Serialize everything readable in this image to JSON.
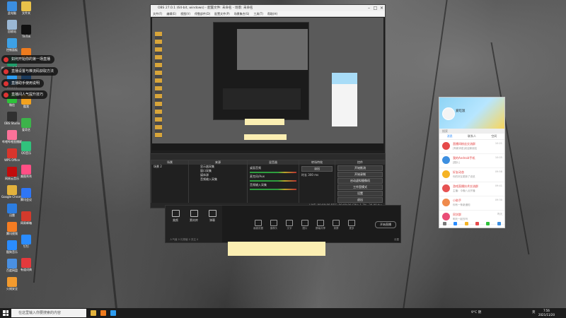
{
  "desktop": {
    "icons_left": [
      {
        "label": "此电脑",
        "color": "#3b8ee0"
      },
      {
        "label": "回收站",
        "color": "#9bb8d4"
      },
      {
        "label": "控制面板",
        "color": "#3da1e6"
      },
      {
        "label": "Microsoft Edge",
        "color": "#1f9d6b"
      },
      {
        "label": "腾讯QQ",
        "color": "#2d9cf0"
      },
      {
        "label": "微信",
        "color": "#2ec23a"
      },
      {
        "label": "OBS Studio",
        "color": "#303030"
      },
      {
        "label": "哔哩哔哩直播姬",
        "color": "#fb7299"
      },
      {
        "label": "WPS Office",
        "color": "#d9352c"
      },
      {
        "label": "网易云音乐",
        "color": "#c20c0c"
      },
      {
        "label": "Google Chrome",
        "color": "#e3b23c"
      },
      {
        "label": "迅雷",
        "color": "#2c7de0"
      },
      {
        "label": "腾讯视频",
        "color": "#f57c22"
      },
      {
        "label": "酷狗音乐",
        "color": "#2a8cff"
      },
      {
        "label": "百度网盘",
        "color": "#4a90e2"
      },
      {
        "label": "火绒安全",
        "color": "#f29a2e"
      }
    ],
    "icons_col2": [
      {
        "label": "文件夹",
        "color": "#e9c24a"
      },
      {
        "label": "TikTok",
        "color": "#111111"
      },
      {
        "label": "火狐",
        "color": "#ee7b1e"
      },
      {
        "label": "Steam",
        "color": "#1b3a5c"
      },
      {
        "label": "酷我",
        "color": "#f2a21f"
      },
      {
        "label": "爱奇艺",
        "color": "#3cb34a"
      },
      {
        "label": "QQ音乐",
        "color": "#31c27c"
      },
      {
        "label": "美图秀秀",
        "color": "#ff4f85"
      },
      {
        "label": "腾讯会议",
        "color": "#2f76f5"
      },
      {
        "label": "网易邮箱",
        "color": "#d33a2c"
      },
      {
        "label": "钉钉",
        "color": "#2a8cff"
      },
      {
        "label": "有道词典",
        "color": "#e4393c"
      }
    ],
    "toasts": [
      {
        "text": "如何开始你的第一场直播"
      },
      {
        "text": "直播设置与推流码获取方法"
      },
      {
        "text": "直播助手使用说明"
      },
      {
        "text": "直播间人气提升技巧"
      }
    ]
  },
  "obs": {
    "title": "OBS 27.0.1 (64-bit, windows) - 配置文件: 未命名 - 场景: 未命名",
    "menu": [
      "文件(F)",
      "编辑(E)",
      "视图(V)",
      "停靠部件(D)",
      "配置文件(P)",
      "场景集合(S)",
      "工具(T)",
      "帮助(H)"
    ],
    "dock": {
      "scenes_header": "场景",
      "scenes": [
        "场景 2"
      ],
      "sources_header": "来源",
      "sources": [
        "显示器采集",
        "窗口采集",
        "媒体源",
        "音频输入采集"
      ],
      "mixer_header": "混音器",
      "mixer": [
        "桌面音频",
        "麦克风/Aux",
        "音频输入采集"
      ],
      "transitions_header": "转场特效",
      "transition_value": "淡出",
      "duration_label": "时长",
      "duration_value": "300 ms",
      "controls_header": "控件",
      "controls": [
        "开始推流",
        "开始录制",
        "启动虚拟摄像机",
        "工作室模式",
        "设置",
        "退出"
      ],
      "status": "LIVE: 00:00:00   REC: 00:00:00   CPU: 1.7%, 30.00 fps"
    }
  },
  "live_app": {
    "side_buttons": [
      "美颜",
      "素材库",
      "弹幕"
    ],
    "tools": [
      "画面设置",
      "摄像头",
      "文字",
      "图片",
      "屏幕共享",
      "录屏",
      "更多"
    ],
    "start_label": "开始直播",
    "bottom_text": "人气值 0   礼物值 0   关注 0",
    "bottom_right": "设置"
  },
  "qq": {
    "name": "爱吃饭",
    "search_placeholder": "搜索",
    "tabs": [
      "消息",
      "联系人",
      "空间"
    ],
    "active_tab": "消息",
    "chats": [
      {
        "name": "直播间粉丝交流群",
        "msg": "[有新消息]欢迎新朋友",
        "time": "10:21",
        "color": "#e64a4a"
      },
      {
        "name": "我的Android手机",
        "msg": "[图片]",
        "time": "10:05",
        "color": "#3d8fe0"
      },
      {
        "name": "好友动态",
        "msg": "你的好友更新了说说",
        "time": "09:58",
        "color": "#f5b324"
      },
      {
        "name": "游戏直播技术交流群",
        "msg": "主播：今晚八点开播",
        "time": "09:41",
        "color": "#e65252"
      },
      {
        "name": "小助手",
        "msg": "你有一条新通知",
        "time": "09:30",
        "color": "#ef8a4c"
      },
      {
        "name": "同学群",
        "msg": "明天一起去吗",
        "time": "昨天",
        "color": "#e94d77"
      }
    ]
  },
  "taskbar": {
    "search_placeholder": "在这里输入你要搜索的内容",
    "weather": "9°C 阴",
    "lang": "英",
    "time": "7:56",
    "date": "2021/11/20"
  }
}
